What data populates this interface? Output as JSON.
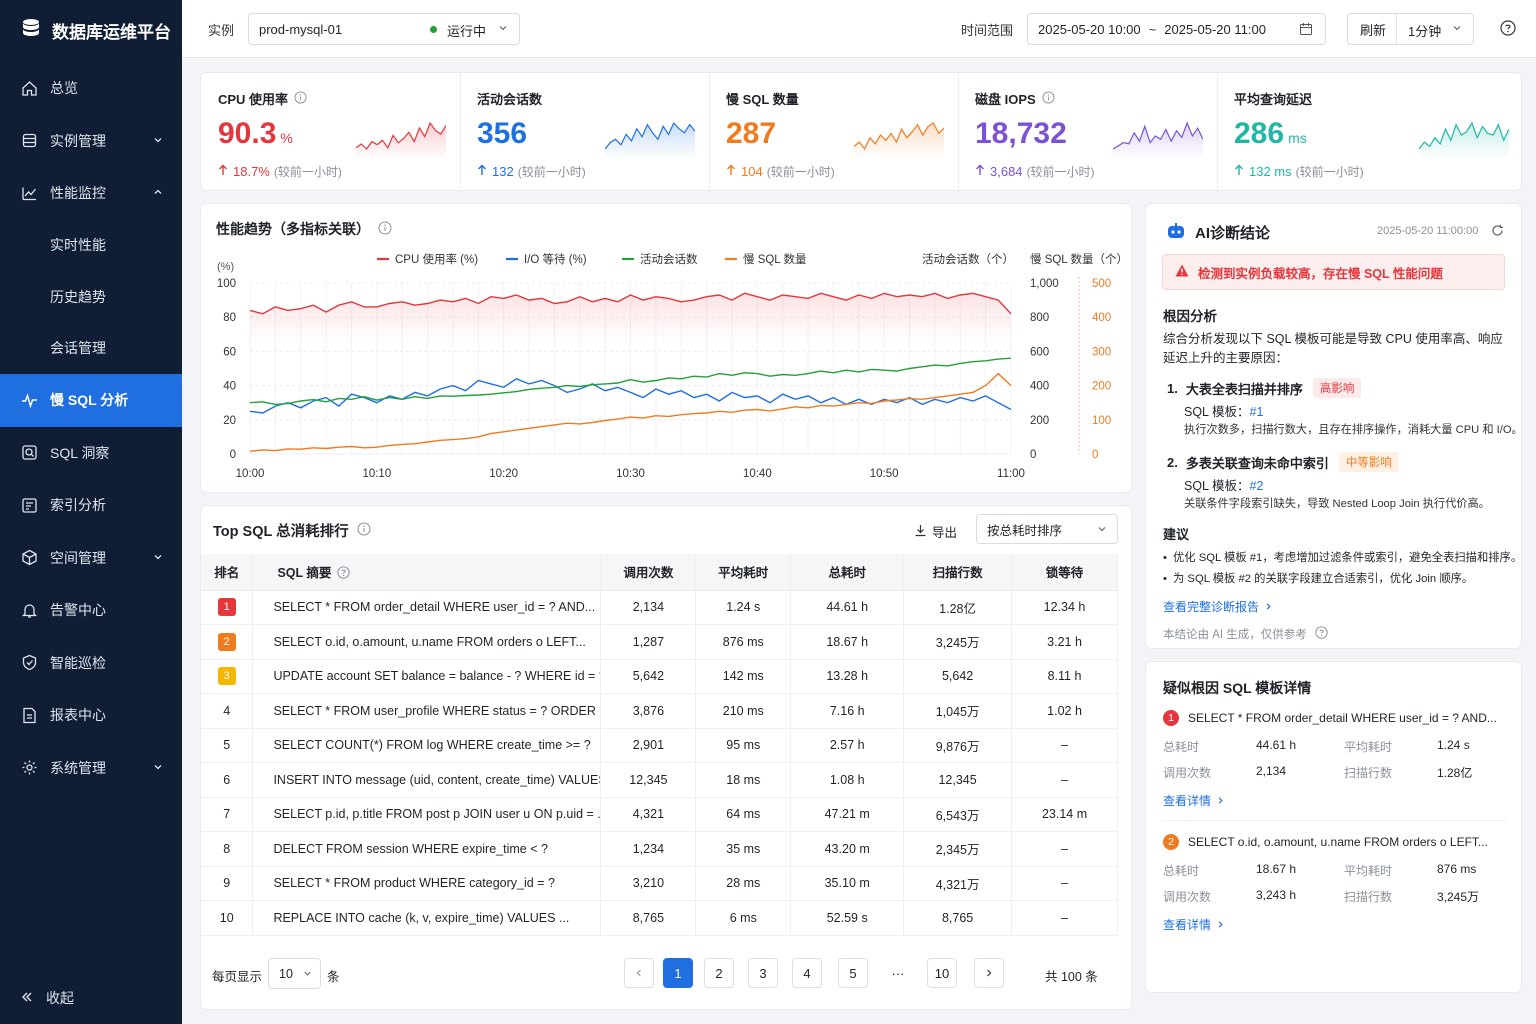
{
  "app": {
    "title": "数据库运维平台"
  },
  "sidebar": {
    "items": [
      {
        "label": "总览",
        "icon": "home-icon"
      },
      {
        "label": "实例管理",
        "icon": "database-icon",
        "chevron": "down"
      },
      {
        "label": "性能监控",
        "icon": "chart-icon",
        "chevron": "up"
      }
    ],
    "subitems": [
      "实时性能",
      "历史趋势",
      "会话管理"
    ],
    "items2": [
      {
        "label": "慢 SQL 分析",
        "icon": "pulse-icon",
        "active": true
      },
      {
        "label": "SQL 洞察",
        "icon": "search-icon"
      },
      {
        "label": "索引分析",
        "icon": "index-icon"
      },
      {
        "label": "空间管理",
        "icon": "cube-icon",
        "chevron": "down"
      },
      {
        "label": "告警中心",
        "icon": "bell-icon"
      },
      {
        "label": "智能巡检",
        "icon": "shield-icon"
      },
      {
        "label": "报表中心",
        "icon": "report-icon"
      },
      {
        "label": "系统管理",
        "icon": "gear-icon",
        "chevron": "down"
      }
    ],
    "collapse_label": "收起"
  },
  "topbar": {
    "instance_label": "实例",
    "instance_value": "prod-mysql-01",
    "instance_status": "运行中",
    "time_label": "时间范围",
    "time_start": "2025-05-20 10:00",
    "time_sep": "~",
    "time_end": "2025-05-20 11:00",
    "refresh_label": "刷新",
    "refresh_interval": "1分钟"
  },
  "metrics": [
    {
      "title": "CPU 使用率",
      "info": true,
      "value": "90.3",
      "unit": "%",
      "delta": "18.7%",
      "compare": "(较前一小时)",
      "color": "#e5363c",
      "spark": [
        30,
        36,
        28,
        40,
        35,
        42,
        30,
        50,
        38,
        45,
        55,
        40,
        62,
        48,
        70,
        58,
        52,
        66
      ]
    },
    {
      "title": "活动会话数",
      "info": false,
      "value": "356",
      "unit": "",
      "delta": "132",
      "compare": "(较前一小时)",
      "color": "#1f6fe0",
      "spark": [
        30,
        38,
        42,
        35,
        48,
        40,
        55,
        45,
        60,
        50,
        42,
        58,
        48,
        62,
        55,
        50,
        60,
        52
      ]
    },
    {
      "title": "慢 SQL 数量",
      "info": false,
      "value": "287",
      "unit": "",
      "delta": "104",
      "compare": "(较前一小时)",
      "color": "#f07b1f",
      "spark": [
        35,
        40,
        32,
        45,
        38,
        48,
        42,
        50,
        40,
        55,
        45,
        52,
        60,
        48,
        58,
        62,
        50,
        56
      ]
    },
    {
      "title": "磁盘 IOPS",
      "info": true,
      "value": "18,732",
      "unit": "",
      "delta": "3,684",
      "compare": "(较前一小时)",
      "color": "#7b52d6",
      "spark": [
        30,
        35,
        40,
        38,
        55,
        42,
        65,
        40,
        50,
        45,
        60,
        42,
        58,
        48,
        70,
        50,
        62,
        45
      ]
    },
    {
      "title": "平均查询延迟",
      "info": false,
      "value": "286",
      "unit": "ms",
      "delta": "132 ms",
      "compare": "(较前一小时)",
      "color": "#1eb8a8",
      "spark": [
        32,
        40,
        35,
        45,
        38,
        55,
        42,
        60,
        48,
        52,
        62,
        45,
        58,
        50,
        48,
        60,
        42,
        55
      ]
    }
  ],
  "trend": {
    "title": "性能趋势（多指标关联）",
    "y_left_unit": "(%)",
    "y_right1_title": "活动会话数（个）",
    "y_right2_title": "慢 SQL 数量（个）",
    "y_left_ticks": [
      "100",
      "80",
      "60",
      "40",
      "20",
      "0"
    ],
    "y_right1_ticks": [
      "1,000",
      "800",
      "600",
      "400",
      "200",
      "0"
    ],
    "y_right2_ticks": [
      "500",
      "400",
      "300",
      "200",
      "100",
      "0"
    ],
    "x_ticks": [
      "10:00",
      "10:10",
      "10:20",
      "10:30",
      "10:40",
      "10:50",
      "11:00"
    ],
    "legend": [
      {
        "label": "CPU 使用率 (%)",
        "color": "#e5363c"
      },
      {
        "label": "I/O 等待 (%)",
        "color": "#1f6fe0"
      },
      {
        "label": "活动会话数",
        "color": "#21a03b"
      },
      {
        "label": "慢 SQL 数量",
        "color": "#f07b1f"
      }
    ]
  },
  "top_sql": {
    "title": "Top SQL 总消耗排行",
    "export_label": "导出",
    "sort_label": "按总耗时排序",
    "columns": [
      "排名",
      "SQL 摘要",
      "调用次数",
      "平均耗时",
      "总耗时",
      "扫描行数",
      "锁等待"
    ],
    "rows": [
      {
        "rank": "1",
        "sql": "SELECT * FROM order_detail WHERE user_id = ? AND...",
        "calls": "2,134",
        "avg": "1.24 s",
        "total": "44.61 h",
        "rows": "1.28亿",
        "lock": "12.34 h"
      },
      {
        "rank": "2",
        "sql": "SELECT o.id, o.amount, u.name FROM orders o LEFT...",
        "calls": "1,287",
        "avg": "876 ms",
        "total": "18.67 h",
        "rows": "3,245万",
        "lock": "3.21 h"
      },
      {
        "rank": "3",
        "sql": "UPDATE account SET balance = balance - ? WHERE id = ?",
        "calls": "5,642",
        "avg": "142 ms",
        "total": "13.28 h",
        "rows": "5,642",
        "lock": "8.11 h"
      },
      {
        "rank": "4",
        "sql": "SELECT * FROM user_profile WHERE status = ? ORDER BY ...",
        "calls": "3,876",
        "avg": "210 ms",
        "total": "7.16 h",
        "rows": "1,045万",
        "lock": "1.02 h"
      },
      {
        "rank": "5",
        "sql": "SELECT COUNT(*) FROM log WHERE create_time >= ?",
        "calls": "2,901",
        "avg": "95 ms",
        "total": "2.57 h",
        "rows": "9,876万",
        "lock": "–"
      },
      {
        "rank": "6",
        "sql": "INSERT INTO message (uid, content, create_time) VALUES ...",
        "calls": "12,345",
        "avg": "18 ms",
        "total": "1.08 h",
        "rows": "12,345",
        "lock": "–"
      },
      {
        "rank": "7",
        "sql": "SELECT p.id, p.title FROM post p JOIN user u ON p.uid = ...",
        "calls": "4,321",
        "avg": "64 ms",
        "total": "47.21 m",
        "rows": "6,543万",
        "lock": "23.14 m"
      },
      {
        "rank": "8",
        "sql": "DELECT FROM session WHERE expire_time < ?",
        "calls": "1,234",
        "avg": "35 ms",
        "total": "43.20 m",
        "rows": "2,345万",
        "lock": "–"
      },
      {
        "rank": "9",
        "sql": "SELECT * FROM product WHERE category_id = ?",
        "calls": "3,210",
        "avg": "28 ms",
        "total": "35.10 m",
        "rows": "4,321万",
        "lock": "–"
      },
      {
        "rank": "10",
        "sql": "REPLACE INTO cache (k, v, expire_time) VALUES ...",
        "calls": "8,765",
        "avg": "6 ms",
        "total": "52.59 s",
        "rows": "8,765",
        "lock": "–"
      }
    ],
    "page_size_label": "每页显示",
    "page_size": "10",
    "page_size_unit": "条",
    "pages": [
      "1",
      "2",
      "3",
      "4",
      "5",
      "···",
      "10"
    ],
    "total_label": "共 100 条"
  },
  "ai": {
    "title": "AI诊断结论",
    "timestamp": "2025-05-20 11:00:00",
    "alert": "检测到实例负载较高，存在慢 SQL 性能问题",
    "root_title": "根因分析",
    "root_desc": "综合分析发现以下 SQL 模板可能是导致 CPU 使用率高、响应延迟上升的主要原因：",
    "causes": [
      {
        "num": "1.",
        "title": "大表全表扫描并排序",
        "tag": "高影响",
        "template_label": "SQL 模板：",
        "template": "#1",
        "desc": "执行次数多，扫描行数大，且存在排序操作，消耗大量 CPU 和 I/O。"
      },
      {
        "num": "2.",
        "title": "多表关联查询未命中索引",
        "tag": "中等影响",
        "template_label": "SQL 模板：",
        "template": "#2",
        "desc": "关联条件字段索引缺失，导致 Nested Loop Join 执行代价高。"
      }
    ],
    "suggest_title": "建议",
    "suggestions": [
      "优化 SQL 模板 #1，考虑增加过滤条件或索引，避免全表扫描和排序。",
      "为 SQL 模板 #2 的关联字段建立合适索引，优化 Join 顺序。"
    ],
    "report_link": "查看完整诊断报告",
    "disclaimer": "本结论由 AI 生成，仅供参考"
  },
  "suspect": {
    "title": "疑似根因 SQL 模板详情",
    "items": [
      {
        "num": "1",
        "sql": "SELECT * FROM order_detail WHERE user_id = ? AND...",
        "total_label": "总耗时",
        "total": "44.61 h",
        "avg_label": "平均耗时",
        "avg": "1.24 s",
        "calls_label": "调用次数",
        "calls": "2,134",
        "rows_label": "扫描行数",
        "rows": "1.28亿",
        "link": "查看详情"
      },
      {
        "num": "2",
        "sql": "SELECT o.id, o.amount, u.name FROM orders o LEFT...",
        "total_label": "总耗时",
        "total": "18.67 h",
        "avg_label": "平均耗时",
        "avg": "876 ms",
        "calls_label": "调用次数",
        "calls": "3,243 h",
        "rows_label": "扫描行数",
        "rows": "3,245万",
        "link": "查看详情"
      }
    ]
  },
  "chart_data": {
    "type": "line",
    "x": [
      "10:00",
      "10:01",
      "10:02",
      "10:03",
      "10:04",
      "10:05",
      "10:06",
      "10:07",
      "10:08",
      "10:09",
      "10:10",
      "10:11",
      "10:12",
      "10:13",
      "10:14",
      "10:15",
      "10:16",
      "10:17",
      "10:18",
      "10:19",
      "10:20",
      "10:21",
      "10:22",
      "10:23",
      "10:24",
      "10:25",
      "10:26",
      "10:27",
      "10:28",
      "10:29",
      "10:30",
      "10:31",
      "10:32",
      "10:33",
      "10:34",
      "10:35",
      "10:36",
      "10:37",
      "10:38",
      "10:39",
      "10:40",
      "10:41",
      "10:42",
      "10:43",
      "10:44",
      "10:45",
      "10:46",
      "10:47",
      "10:48",
      "10:49",
      "10:50",
      "10:51",
      "10:52",
      "10:53",
      "10:54",
      "10:55",
      "10:56",
      "10:57",
      "10:58",
      "10:59",
      "11:00"
    ],
    "series": [
      {
        "name": "CPU 使用率 (%)",
        "axis": "left",
        "values": [
          84,
          82,
          86,
          84,
          85,
          87,
          83,
          87,
          89,
          86,
          86,
          88,
          89,
          87,
          88,
          90,
          89,
          91,
          88,
          92,
          91,
          93,
          90,
          91,
          88,
          89,
          92,
          89,
          91,
          89,
          93,
          90,
          92,
          91,
          89,
          90,
          92,
          93,
          90,
          94,
          92,
          90,
          93,
          92,
          91,
          94,
          92,
          90,
          93,
          91,
          94,
          92,
          93,
          92,
          94,
          91,
          93,
          94,
          92,
          90,
          82
        ]
      },
      {
        "name": "I/O 等待 (%)",
        "axis": "left",
        "values": [
          25,
          24,
          28,
          30,
          27,
          31,
          33,
          28,
          35,
          33,
          30,
          34,
          32,
          36,
          34,
          38,
          40,
          37,
          43,
          41,
          39,
          44,
          41,
          43,
          40,
          36,
          38,
          41,
          37,
          39,
          36,
          33,
          38,
          35,
          37,
          33,
          35,
          31,
          36,
          33,
          34,
          30,
          35,
          32,
          34,
          30,
          33,
          29,
          32,
          29,
          32,
          30,
          33,
          29,
          32,
          30,
          33,
          31,
          34,
          30,
          26
        ]
      },
      {
        "name": "活动会话数",
        "axis": "right1",
        "values": [
          300,
          305,
          290,
          295,
          310,
          318,
          305,
          325,
          320,
          335,
          315,
          330,
          320,
          335,
          325,
          340,
          338,
          342,
          345,
          350,
          358,
          365,
          378,
          385,
          390,
          400,
          395,
          405,
          410,
          415,
          435,
          420,
          430,
          445,
          440,
          455,
          450,
          470,
          460,
          475,
          470,
          455,
          465,
          460,
          470,
          485,
          475,
          490,
          480,
          495,
          490,
          485,
          500,
          510,
          520,
          515,
          530,
          540,
          545,
          555,
          560
        ]
      },
      {
        "name": "慢 SQL 数量",
        "axis": "right2",
        "values": [
          8,
          12,
          10,
          15,
          14,
          18,
          16,
          20,
          22,
          18,
          20,
          25,
          28,
          30,
          35,
          40,
          42,
          45,
          50,
          60,
          65,
          70,
          75,
          80,
          85,
          90,
          88,
          92,
          98,
          102,
          108,
          105,
          112,
          110,
          115,
          118,
          120,
          125,
          122,
          128,
          130,
          126,
          132,
          138,
          135,
          142,
          140,
          145,
          150,
          148,
          155,
          158,
          162,
          160,
          165,
          170,
          175,
          180,
          200,
          235,
          200
        ]
      }
    ],
    "y_left": {
      "unit": "(%)",
      "ylim": [
        0,
        100
      ]
    },
    "y_right1": {
      "title": "活动会话数（个）",
      "ylim": [
        0,
        1000
      ]
    },
    "y_right2": {
      "title": "慢 SQL 数量（个）",
      "ylim": [
        0,
        500
      ]
    },
    "legend_position": "top",
    "grid": true
  }
}
